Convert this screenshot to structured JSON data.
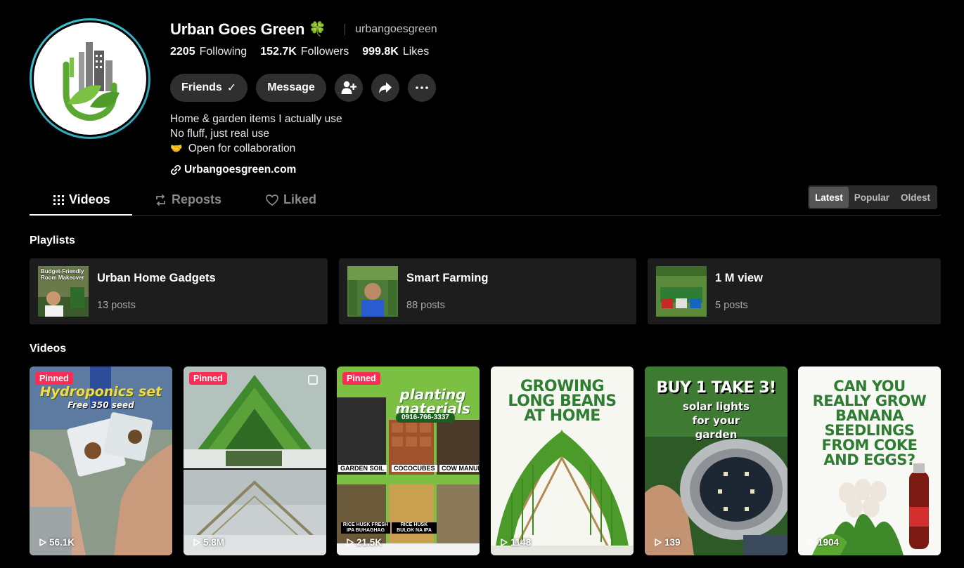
{
  "profile": {
    "display_name": "Urban Goes Green",
    "badge_emoji": "🍀",
    "username": "urbangoesgreen",
    "stats": {
      "following_count": "2205",
      "following_label": "Following",
      "followers_count": "152.7K",
      "followers_label": "Followers",
      "likes_count": "999.8K",
      "likes_label": "Likes"
    },
    "actions": {
      "friends_label": "Friends",
      "message_label": "Message"
    },
    "bio": {
      "line1": "Home & garden items I actually use",
      "line2": "No fluff, just real use",
      "line3_emoji": "🤝",
      "line3": "Open for collaboration"
    },
    "link": "Urbangoesgreen.com"
  },
  "tabs": [
    {
      "label": "Videos",
      "icon": "grid-icon",
      "active": true
    },
    {
      "label": "Reposts",
      "icon": "repost-icon",
      "active": false
    },
    {
      "label": "Liked",
      "icon": "heart-icon",
      "active": false
    }
  ],
  "sort": {
    "options": [
      "Latest",
      "Popular",
      "Oldest"
    ],
    "selected": "Latest"
  },
  "sections": {
    "playlists": "Playlists",
    "videos": "Videos"
  },
  "playlists": [
    {
      "title": "Urban Home Gadgets",
      "count": "13 posts",
      "thumb_text": "Budget-Friendly Room Makeover"
    },
    {
      "title": "Smart Farming",
      "count": "88 posts",
      "thumb_text": ""
    },
    {
      "title": "1 M view",
      "count": "5 posts",
      "thumb_text": ""
    }
  ],
  "videos": [
    {
      "pinned": "Pinned",
      "views": "56.1K",
      "headline": "Hydroponics set",
      "sub": "Free 350 seed"
    },
    {
      "pinned": "Pinned",
      "views": "5.8M",
      "headline": "",
      "sub": ""
    },
    {
      "pinned": "Pinned",
      "views": "21.5K",
      "headline": "planting materials",
      "sub": "0916-766-3337",
      "labels": [
        "GARDEN SOIL",
        "COCOCUBES",
        "COW MANURE",
        "RICE HUSK FRESH IPA BUHAGHAG",
        "RICE HUSK BULOK NA IPA"
      ]
    },
    {
      "pinned": "",
      "views": "1148",
      "headline": "GROWING LONG BEANS AT HOME",
      "sub": ""
    },
    {
      "pinned": "",
      "views": "139",
      "headline": "BUY 1 TAKE 3!",
      "sub": "solar lights for your garden"
    },
    {
      "pinned": "",
      "views": "1904",
      "headline": "CAN YOU REALLY GROW BANANA SEEDLINGS FROM COKE AND EGGS?",
      "sub": ""
    }
  ],
  "colors": {
    "background": "#000000",
    "pill": "#2f2f2f",
    "pinned": "#fe2c55",
    "avatar_ring": "#3fc7d6",
    "brand_green": "#5aa832"
  }
}
